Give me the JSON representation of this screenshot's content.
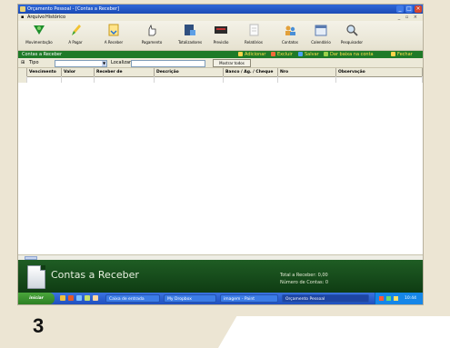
{
  "window": {
    "title": "Orçamento Pessoal - [Contas a Receber]"
  },
  "menu": [
    {
      "label": "Arquivo"
    },
    {
      "label": "Histórico"
    }
  ],
  "toolbar": [
    {
      "label": "Movimentação",
      "icon": "movimentacao-icon"
    },
    {
      "label": "A Pagar",
      "icon": "pencil-icon"
    },
    {
      "label": "A Receber",
      "icon": "document-icon"
    },
    {
      "label": "Pagamento",
      "icon": "hand-icon"
    },
    {
      "label": "Totalizadores",
      "icon": "totalizadores-icon"
    },
    {
      "label": "Previsão",
      "icon": "previsao-icon"
    },
    {
      "label": "Relatórios",
      "icon": "report-icon"
    },
    {
      "label": "Contatos",
      "icon": "contacts-icon"
    },
    {
      "label": "Calendário",
      "icon": "calendar-icon"
    },
    {
      "label": "Pesquisador",
      "icon": "search-icon"
    }
  ],
  "actionbar": {
    "title": "Contas a Receber",
    "actions": [
      {
        "label": "Adicionar",
        "color": "#ffd34a"
      },
      {
        "label": "Excluir",
        "color": "#f26a3a"
      },
      {
        "label": "Salvar",
        "color": "#4aa0f2"
      },
      {
        "label": "Dar baixa na conta",
        "color": "#9ad14a"
      },
      {
        "label": "Fechar",
        "color": "#ffd34a"
      }
    ]
  },
  "filter": {
    "tipo_label": "Tipo",
    "localizar_label": "Localizar:",
    "button_label": "Mostrar todos"
  },
  "columns": [
    {
      "label": "Vencimento"
    },
    {
      "label": "Valor"
    },
    {
      "label": "Receber de"
    },
    {
      "label": "Descrição"
    },
    {
      "label": "Banco / Ag. / Cheque"
    },
    {
      "label": "Nro"
    },
    {
      "label": "Observação"
    }
  ],
  "banner": {
    "title": "Contas a Receber",
    "total_label": "Total a Receber: 0,00",
    "count_label": "Número de Contas: 0"
  },
  "taskbar": {
    "start_label": "iniciar",
    "tasks": [
      {
        "label": "Caixa de entrada"
      },
      {
        "label": "My Dropbox"
      },
      {
        "label": "imagem - Paint"
      },
      {
        "label": "Orçamento Pessoal"
      }
    ],
    "clock": "10:44"
  },
  "step": "3"
}
